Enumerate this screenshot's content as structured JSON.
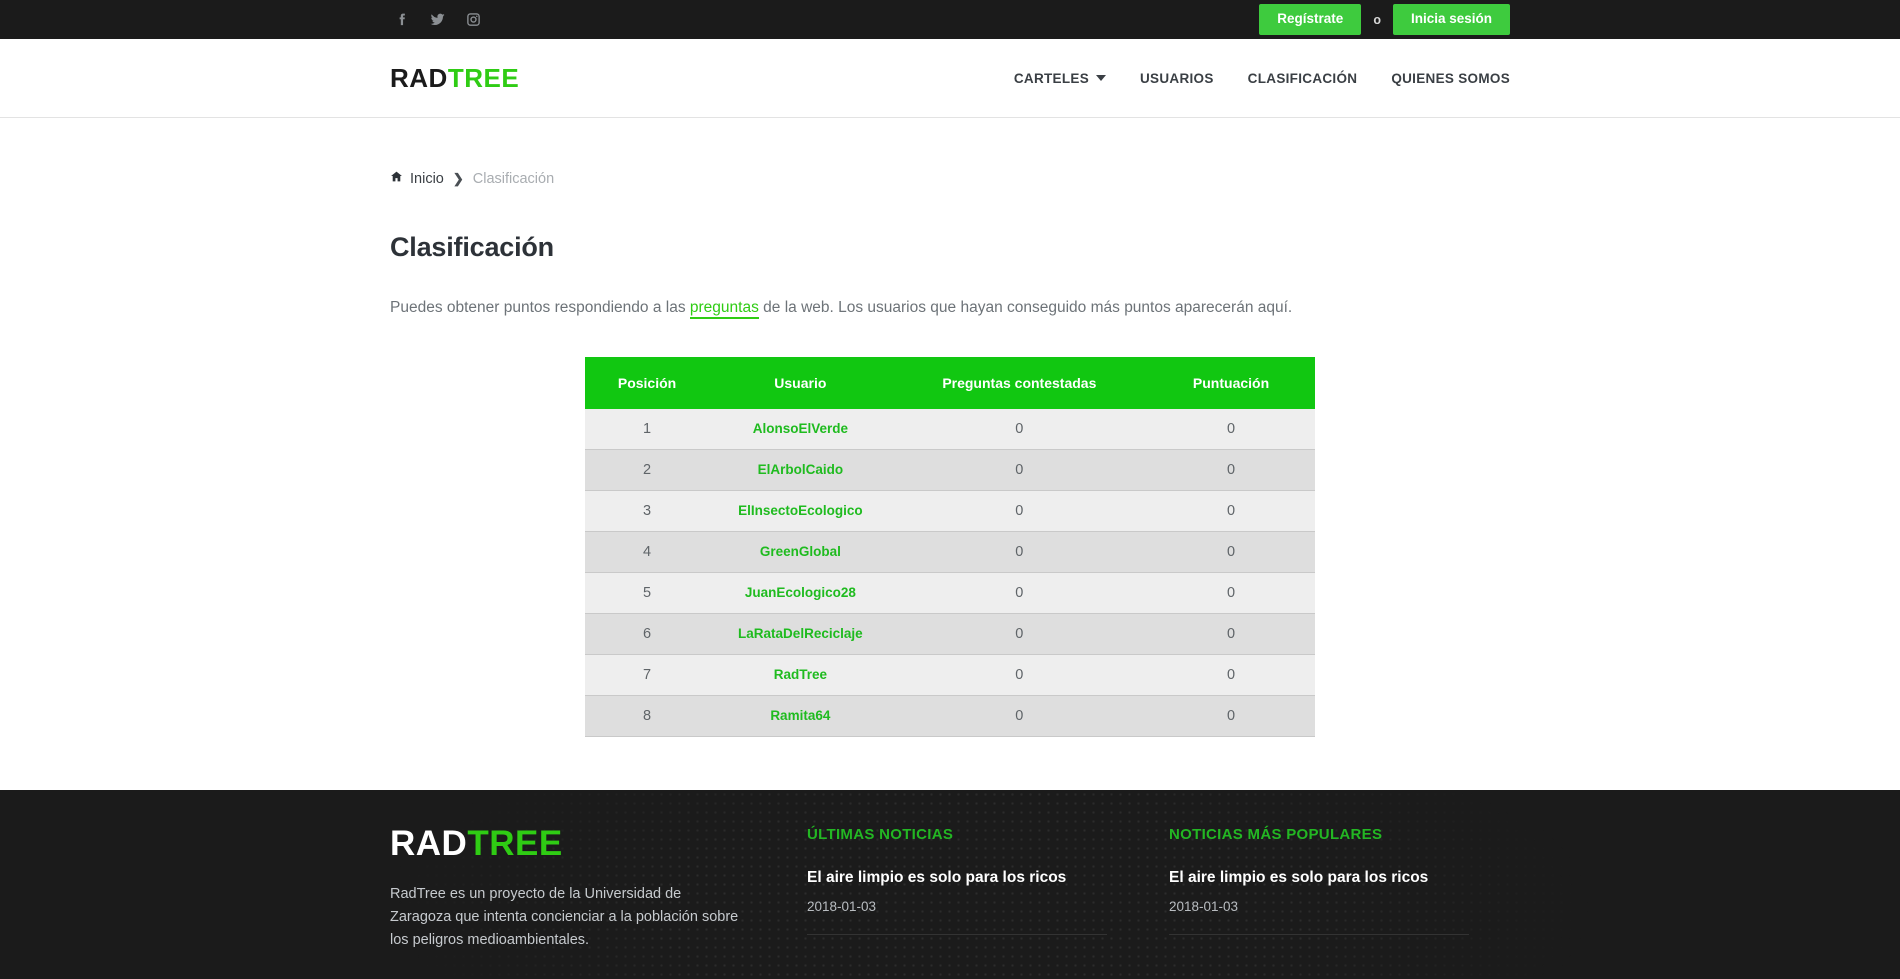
{
  "topbar": {
    "social": [
      {
        "name": "facebook-icon",
        "label": "Facebook"
      },
      {
        "name": "twitter-icon",
        "label": "Twitter"
      },
      {
        "name": "instagram-icon",
        "label": "Instagram"
      }
    ],
    "register_label": "Regístrate",
    "separator": "o",
    "login_label": "Inicia sesión",
    "accent": "#3ecb3e",
    "background": "#1b1b1b"
  },
  "header": {
    "logo_first": "RAD",
    "logo_second": "TREE",
    "nav": [
      {
        "label": "CARTELES",
        "has_dropdown": true
      },
      {
        "label": "USUARIOS",
        "has_dropdown": false
      },
      {
        "label": "CLASIFICACIÓN",
        "has_dropdown": false
      },
      {
        "label": "QUIENES SOMOS",
        "has_dropdown": false
      }
    ]
  },
  "breadcrumb": {
    "home_label": "Inicio",
    "separator": "❯",
    "current": "Clasificación"
  },
  "main": {
    "title": "Clasificación",
    "intro_before": "Puedes obtener puntos respondiendo a las ",
    "intro_link": "preguntas",
    "intro_after": " de la web. Los usuarios que hayan conseguido más puntos aparecerán aquí.",
    "table": {
      "columns": [
        "Posición",
        "Usuario",
        "Preguntas contestadas",
        "Puntuación"
      ],
      "rows": [
        {
          "position": "1",
          "user": "AlonsoElVerde",
          "answered": "0",
          "score": "0"
        },
        {
          "position": "2",
          "user": "ElArbolCaido",
          "answered": "0",
          "score": "0"
        },
        {
          "position": "3",
          "user": "ElInsectoEcologico",
          "answered": "0",
          "score": "0"
        },
        {
          "position": "4",
          "user": "GreenGlobal",
          "answered": "0",
          "score": "0"
        },
        {
          "position": "5",
          "user": "JuanEcologico28",
          "answered": "0",
          "score": "0"
        },
        {
          "position": "6",
          "user": "LaRataDelReciclaje",
          "answered": "0",
          "score": "0"
        },
        {
          "position": "7",
          "user": "RadTree",
          "answered": "0",
          "score": "0"
        },
        {
          "position": "8",
          "user": "Ramita64",
          "answered": "0",
          "score": "0"
        }
      ]
    }
  },
  "footer": {
    "logo_first": "RAD",
    "logo_second": "TREE",
    "description": "RadTree es un proyecto de la Universidad de Zaragoza que intenta concienciar a la población sobre los peligros medioambientales.",
    "latest": {
      "heading": "ÚLTIMAS NOTICIAS",
      "items": [
        {
          "title": "El aire limpio es solo para los ricos",
          "date": "2018-01-03"
        }
      ]
    },
    "popular": {
      "heading": "NOTICIAS MÁS POPULARES",
      "items": [
        {
          "title": "El aire limpio es solo para los ricos",
          "date": "2018-01-03"
        }
      ]
    }
  },
  "colors": {
    "green": "#2fcc14",
    "table_header_green": "#11c711",
    "dark": "#1b1b1b"
  }
}
